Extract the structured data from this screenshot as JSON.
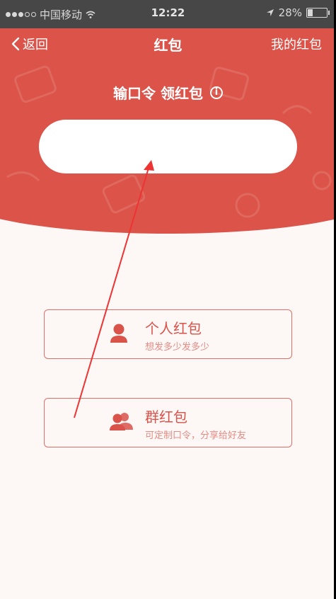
{
  "status_bar": {
    "carrier": "中国移动",
    "time": "12:22",
    "battery_percent": "28%",
    "battery_level": 0.28
  },
  "navbar": {
    "back_label": "返回",
    "title": "红包",
    "right_label": "我的红包"
  },
  "redeem": {
    "prompt": "输口令 领红包",
    "input_value": "",
    "input_placeholder": ""
  },
  "options": [
    {
      "title": "个人红包",
      "subtitle": "想发多少发多少",
      "icon": "person-icon"
    },
    {
      "title": "群红包",
      "subtitle": "可定制口令，分享给好友",
      "icon": "group-icon"
    }
  ],
  "colors": {
    "header_red": "#db5349",
    "accent": "#d9534a",
    "background": "#fdf7f6",
    "annotation_arrow": "#ee3333"
  }
}
